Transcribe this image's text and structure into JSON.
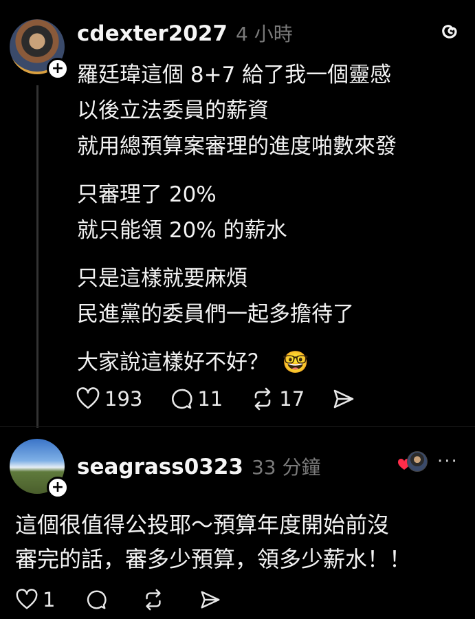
{
  "post": {
    "username": "cdexter2027",
    "time": "4 小時",
    "paragraphs": [
      [
        "羅廷瑋這個 8+7 給了我一個靈感",
        "以後立法委員的薪資",
        "就用總預算案審理的進度啪數來發"
      ],
      [
        "只審理了 20%",
        "就只能領 20% 的薪水"
      ],
      [
        "只是這樣就要麻煩",
        "民進黨的委員們一起多擔待了"
      ],
      [
        "大家說這樣好不好？"
      ]
    ],
    "emoji": "🤓",
    "likes": "193",
    "comments": "11",
    "reposts": "17"
  },
  "reply": {
    "username": "seagrass0323",
    "time": "33 分鐘",
    "lines": [
      "這個很值得公投耶～預算年度開始前沒",
      "審完的話，審多少預算，領多少薪水！！"
    ],
    "likes": "1",
    "more": "···"
  },
  "icons": {
    "app": "threads-logo-icon",
    "follow": "plus-icon",
    "like": "heart-icon",
    "comment": "comment-bubble-icon",
    "repost": "repost-icon",
    "share": "send-icon",
    "liked_by_author": "red-heart-icon"
  },
  "colors": {
    "background": "#000000",
    "text": "#f3f3f3",
    "muted": "#7a7a7a",
    "heart": "#ff2d4a"
  }
}
